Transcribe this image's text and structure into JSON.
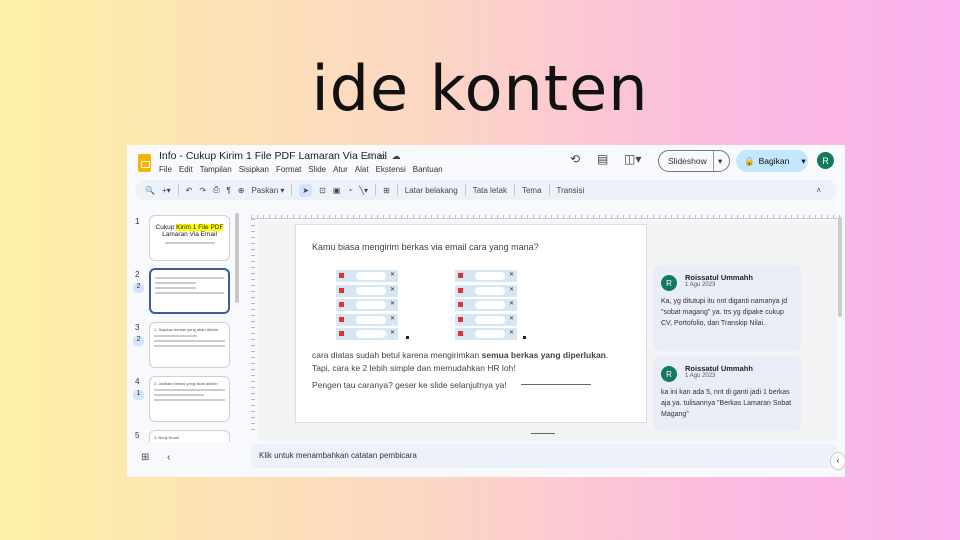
{
  "headline": "ide konten",
  "doc": {
    "title": "Info - Cukup Kirim 1 File PDF Lamaran Via Email",
    "menu": [
      "File",
      "Edit",
      "Tampilan",
      "Sisipkan",
      "Format",
      "Slide",
      "Atur",
      "Alat",
      "Ekstensi",
      "Bantuan"
    ],
    "slideshow_label": "Slideshow",
    "share_label": "Bagikan",
    "avatar": "R"
  },
  "toolbar": {
    "zoom_label": "Paskan",
    "items": [
      "Latar belakang",
      "Tata letak",
      "Tema",
      "Transisi"
    ]
  },
  "thumbnails": [
    {
      "num": "1",
      "title": "Cukup ",
      "highlight": "Kirim 1 File PDF",
      "title2": "Lamaran Via Email"
    },
    {
      "num": "2",
      "comments": "2"
    },
    {
      "num": "3",
      "comments": "2",
      "heading": "1. Siapkan berkas yang akan dikirim"
    },
    {
      "num": "4",
      "comments": "1",
      "heading": "2. Jadikan berkas yang akan dikirim"
    },
    {
      "num": "5",
      "heading": "3. Body Email"
    }
  ],
  "slide": {
    "question": "Kamu biasa mengirim berkas via email cara yang mana?",
    "p1_a": "cara diatas sudah betul karena mengirimkan ",
    "p1_bold": "semua berkas yang diperlukan",
    "p1_b": ".",
    "p1_c": "Tapi, cara ke 2 lebih simple dan memudahkan HR loh!",
    "p2": "Pengen tau caranya? geser ke slide selanjutnya ya!"
  },
  "comments": [
    {
      "avatar": "R",
      "name": "Roissatul Ummahh",
      "date": "1 Agu 2023",
      "text": "Ka, yg ditutupi itu nnt diganti namanya jd \"sobat magang\" ya. trs yg dipake cukup CV, Portofolio, dan Transkip Nilai."
    },
    {
      "avatar": "R",
      "name": "Roissatul Ummahh",
      "date": "1 Agu 2023",
      "text": "ka ini kan ada 5, nnt di ganti jadi 1 berkas aja ya. tulisannya \"Berkas Lamaran Sobat Magang\""
    }
  ],
  "notes_placeholder": "Klik untuk menambahkan catatan pembicara"
}
